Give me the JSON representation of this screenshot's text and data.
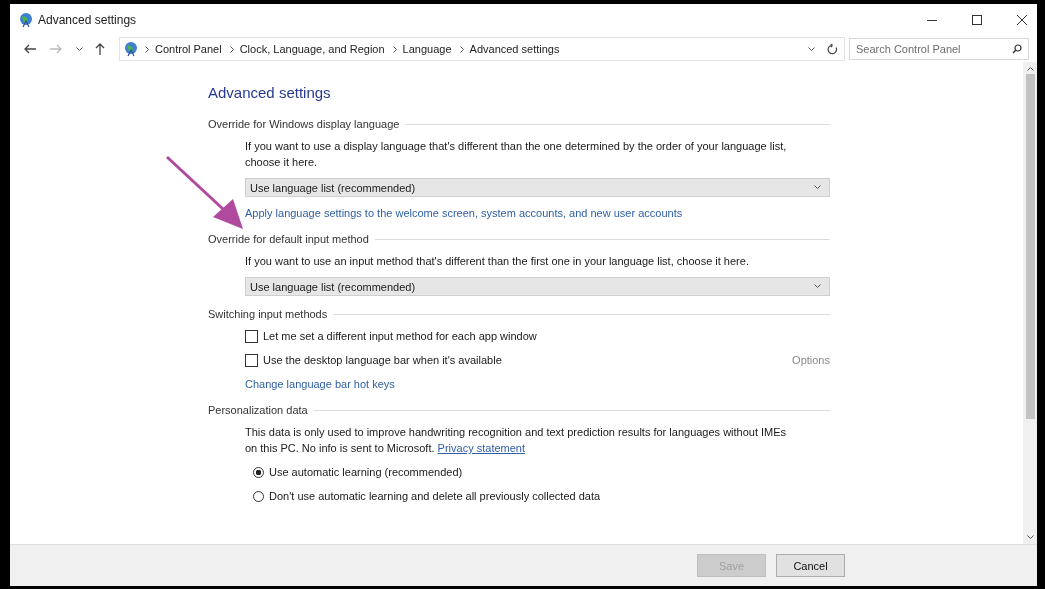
{
  "window": {
    "title": "Advanced settings"
  },
  "address_bar": {
    "breadcrumbs": [
      "Control Panel",
      "Clock, Language, and Region",
      "Language",
      "Advanced settings"
    ],
    "search": {
      "placeholder": "Search Control Panel"
    }
  },
  "page": {
    "heading": "Advanced settings",
    "sections": [
      {
        "title": "Override for Windows display language",
        "items": [
          {
            "kind": "text",
            "text": "If you want to use a display language that's different than the one determined by the order of your language list, choose it here."
          },
          {
            "kind": "dropdown",
            "value": "Use language list (recommended)"
          },
          {
            "kind": "link",
            "text": "Apply language settings to the welcome screen, system accounts, and new user accounts"
          }
        ]
      },
      {
        "title": "Override for default input method",
        "items": [
          {
            "kind": "text",
            "text": "If you want to use an input method that's different than the first one in your language list, choose it here."
          },
          {
            "kind": "dropdown",
            "value": "Use language list (recommended)"
          }
        ]
      },
      {
        "title": "Switching input methods",
        "items": [
          {
            "kind": "checkbox",
            "label": "Let me set a different input method for each app window",
            "checked": false
          },
          {
            "kind": "checkbox",
            "label": "Use the desktop language bar when it's available",
            "checked": false,
            "option": {
              "label": "Options",
              "disabled": true
            }
          },
          {
            "kind": "link",
            "text": "Change language bar hot keys"
          }
        ]
      },
      {
        "title": "Personalization data",
        "items": [
          {
            "kind": "text",
            "text": "This data is only used to improve handwriting recognition and text prediction results for languages without IMEs on this PC. No info is sent to Microsoft.",
            "link": "Privacy statement"
          },
          {
            "kind": "radio",
            "label": "Use automatic learning (recommended)",
            "selected": true
          },
          {
            "kind": "radio",
            "label": "Don't use automatic learning and delete all previously collected data",
            "selected": false
          }
        ]
      }
    ]
  },
  "footer": {
    "buttons": [
      {
        "label": "Save",
        "disabled": true
      },
      {
        "label": "Cancel",
        "disabled": false
      }
    ]
  }
}
